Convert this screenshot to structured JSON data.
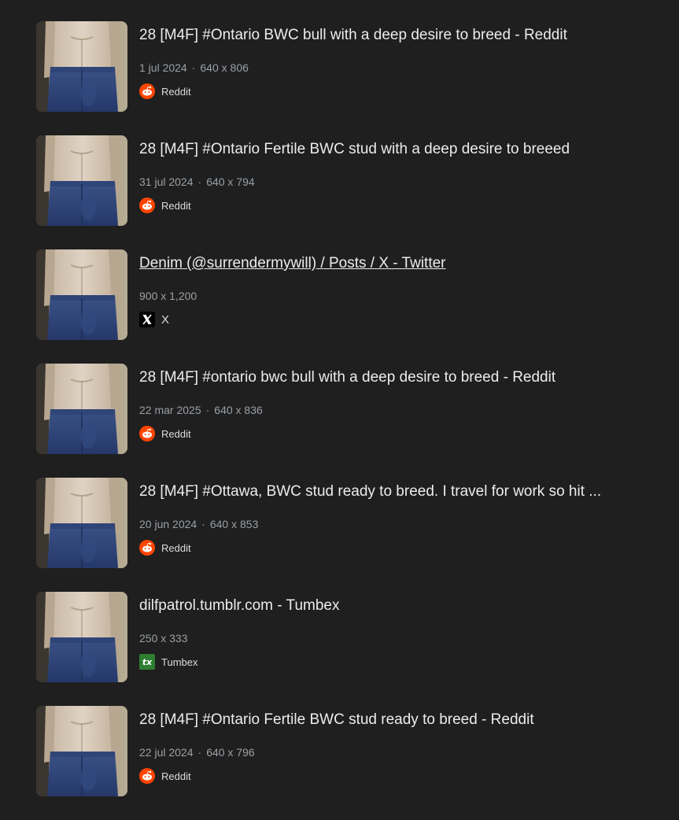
{
  "results": [
    {
      "title": "28 [M4F] #Ontario BWC bull with a deep desire to breed - Reddit",
      "date": "1 jul 2024",
      "dimensions": "640 x 806",
      "source": "Reddit",
      "source_icon": "reddit-icon",
      "underlined": false
    },
    {
      "title": "28 [M4F] #Ontario Fertile BWC stud with a deep desire to breeed",
      "date": "31 jul 2024",
      "dimensions": "640 x 794",
      "source": "Reddit",
      "source_icon": "reddit-icon",
      "underlined": false
    },
    {
      "title": "Denim (@surrendermywill) / Posts / X - Twitter",
      "date": "",
      "dimensions": "900 x 1,200",
      "source": "X",
      "source_icon": "x-icon",
      "underlined": true
    },
    {
      "title": "28 [M4F] #ontario bwc bull with a deep desire to breed - Reddit",
      "date": "22 mar 2025",
      "dimensions": "640 x 836",
      "source": "Reddit",
      "source_icon": "reddit-icon",
      "underlined": false
    },
    {
      "title": "28 [M4F] #Ottawa, BWC stud ready to breed. I travel for work so hit ...",
      "date": "20 jun 2024",
      "dimensions": "640 x 853",
      "source": "Reddit",
      "source_icon": "reddit-icon",
      "underlined": false
    },
    {
      "title": "dilfpatrol.tumblr.com - Tumbex",
      "date": "",
      "dimensions": "250 x 333",
      "source": "Tumbex",
      "source_icon": "tumbex-icon",
      "underlined": false
    },
    {
      "title": "28 [M4F] #Ontario Fertile BWC stud ready to breed - Reddit",
      "date": "22 jul 2024",
      "dimensions": "640 x 796",
      "source": "Reddit",
      "source_icon": "reddit-icon",
      "underlined": false
    }
  ],
  "colors": {
    "background": "#1f1f1f",
    "reddit": "#ff4500",
    "tumbex": "#2e7d32"
  }
}
